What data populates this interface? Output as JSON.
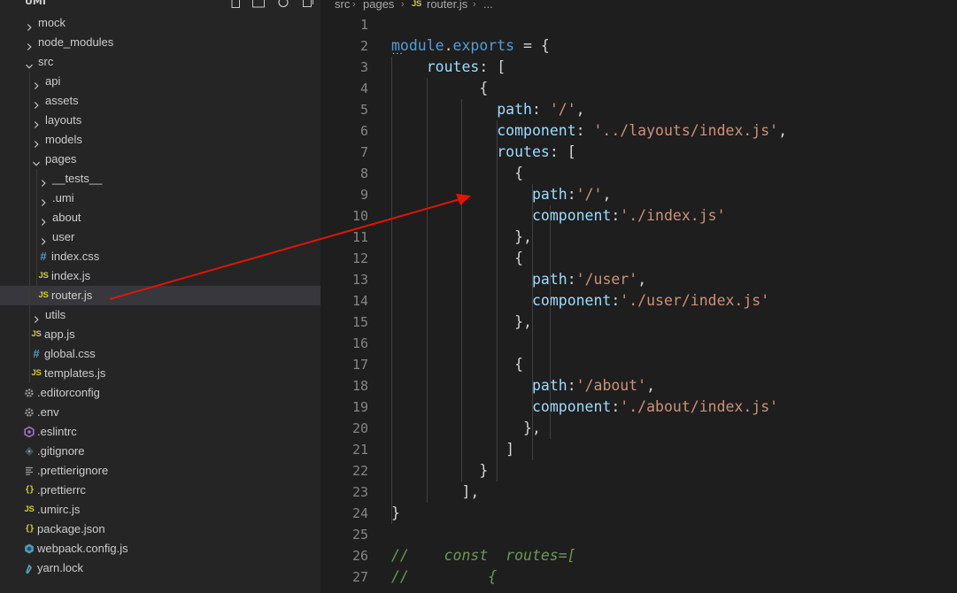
{
  "explorer": {
    "title": "UMI",
    "toolbar": [
      "new-file-icon",
      "new-folder-icon",
      "refresh-icon",
      "collapse-all-icon"
    ],
    "items": [
      {
        "label": "mock",
        "kind": "folder",
        "open": false,
        "indent": 0
      },
      {
        "label": "node_modules",
        "kind": "folder",
        "open": false,
        "indent": 0
      },
      {
        "label": "src",
        "kind": "folder",
        "open": true,
        "indent": 0
      },
      {
        "label": "api",
        "kind": "folder",
        "open": false,
        "indent": 1
      },
      {
        "label": "assets",
        "kind": "folder",
        "open": false,
        "indent": 1
      },
      {
        "label": "layouts",
        "kind": "folder",
        "open": false,
        "indent": 1
      },
      {
        "label": "models",
        "kind": "folder",
        "open": false,
        "indent": 1
      },
      {
        "label": "pages",
        "kind": "folder",
        "open": true,
        "indent": 1
      },
      {
        "label": "__tests__",
        "kind": "folder",
        "open": false,
        "indent": 2
      },
      {
        "label": ".umi",
        "kind": "folder",
        "open": false,
        "indent": 2
      },
      {
        "label": "about",
        "kind": "folder",
        "open": false,
        "indent": 2
      },
      {
        "label": "user",
        "kind": "folder",
        "open": false,
        "indent": 2
      },
      {
        "label": "index.css",
        "kind": "css",
        "indent": 2
      },
      {
        "label": "index.js",
        "kind": "js",
        "indent": 2
      },
      {
        "label": "router.js",
        "kind": "js",
        "indent": 2,
        "selected": true
      },
      {
        "label": "utils",
        "kind": "folder",
        "open": false,
        "indent": 1
      },
      {
        "label": "app.js",
        "kind": "js",
        "indent": 1
      },
      {
        "label": "global.css",
        "kind": "css",
        "indent": 1
      },
      {
        "label": "templates.js",
        "kind": "js",
        "indent": 1
      },
      {
        "label": ".editorconfig",
        "kind": "gear",
        "indent": 0
      },
      {
        "label": ".env",
        "kind": "gear",
        "indent": 0
      },
      {
        "label": ".eslintrc",
        "kind": "eslint",
        "indent": 0
      },
      {
        "label": ".gitignore",
        "kind": "git",
        "indent": 0
      },
      {
        "label": ".prettierignore",
        "kind": "lines",
        "indent": 0
      },
      {
        "label": ".prettierrc",
        "kind": "json",
        "indent": 0
      },
      {
        "label": ".umirc.js",
        "kind": "js",
        "indent": 0
      },
      {
        "label": "package.json",
        "kind": "json",
        "indent": 0
      },
      {
        "label": "webpack.config.js",
        "kind": "webpack",
        "indent": 0
      },
      {
        "label": "yarn.lock",
        "kind": "yarn",
        "indent": 0
      }
    ]
  },
  "breadcrumb": {
    "parts": [
      "src",
      "pages",
      "router.js",
      "..."
    ],
    "file_icon": "JS"
  },
  "editor": {
    "first_line_number": 1,
    "lines": [
      [],
      [
        [
          "kw",
          "module"
        ],
        [
          "pun",
          "."
        ],
        [
          "kw",
          "exports"
        ],
        [
          "pun",
          " = {"
        ]
      ],
      [
        [
          "pun",
          "    "
        ],
        [
          "prop",
          "routes"
        ],
        [
          "pun",
          ": ["
        ]
      ],
      [
        [
          "pun",
          "          {"
        ]
      ],
      [
        [
          "pun",
          "            "
        ],
        [
          "prop",
          "path"
        ],
        [
          "pun",
          ": "
        ],
        [
          "str",
          "'/'"
        ],
        [
          "pun",
          ","
        ]
      ],
      [
        [
          "pun",
          "            "
        ],
        [
          "prop",
          "component"
        ],
        [
          "pun",
          ": "
        ],
        [
          "str",
          "'../layouts/index.js'"
        ],
        [
          "pun",
          ","
        ]
      ],
      [
        [
          "pun",
          "            "
        ],
        [
          "prop",
          "routes"
        ],
        [
          "pun",
          ": ["
        ]
      ],
      [
        [
          "pun",
          "              {"
        ]
      ],
      [
        [
          "pun",
          "                "
        ],
        [
          "prop",
          "path"
        ],
        [
          "pun",
          ":"
        ],
        [
          "str",
          "'/'"
        ],
        [
          "pun",
          ","
        ]
      ],
      [
        [
          "pun",
          "                "
        ],
        [
          "prop",
          "component"
        ],
        [
          "pun",
          ":"
        ],
        [
          "str",
          "'./index.js'"
        ]
      ],
      [
        [
          "pun",
          "              },"
        ]
      ],
      [
        [
          "pun",
          "              {"
        ]
      ],
      [
        [
          "pun",
          "                "
        ],
        [
          "prop",
          "path"
        ],
        [
          "pun",
          ":"
        ],
        [
          "str",
          "'/user'"
        ],
        [
          "pun",
          ","
        ]
      ],
      [
        [
          "pun",
          "                "
        ],
        [
          "prop",
          "component"
        ],
        [
          "pun",
          ":"
        ],
        [
          "str",
          "'./user/index.js'"
        ]
      ],
      [
        [
          "pun",
          "              },"
        ]
      ],
      [],
      [
        [
          "pun",
          "              {"
        ]
      ],
      [
        [
          "pun",
          "                "
        ],
        [
          "prop",
          "path"
        ],
        [
          "pun",
          ":"
        ],
        [
          "str",
          "'/about'"
        ],
        [
          "pun",
          ","
        ]
      ],
      [
        [
          "pun",
          "                "
        ],
        [
          "prop",
          "component"
        ],
        [
          "pun",
          ":"
        ],
        [
          "str",
          "'./about/index.js'"
        ]
      ],
      [
        [
          "pun",
          "               },"
        ]
      ],
      [
        [
          "pun",
          "             ]"
        ]
      ],
      [
        [
          "pun",
          "          }"
        ]
      ],
      [
        [
          "pun",
          "        ],"
        ]
      ],
      [
        [
          "pun",
          "}"
        ]
      ],
      [],
      [
        [
          "cmt",
          "//    const  routes=["
        ]
      ],
      [
        [
          "cmt",
          "//         {"
        ]
      ]
    ]
  },
  "colors": {
    "annotation_arrow": "#e51400",
    "keyword": "#569cd6",
    "property": "#9cdcfe",
    "string": "#ce9178",
    "comment": "#6a9955",
    "js_icon": "#cbcb41",
    "css_icon": "#519aba"
  }
}
